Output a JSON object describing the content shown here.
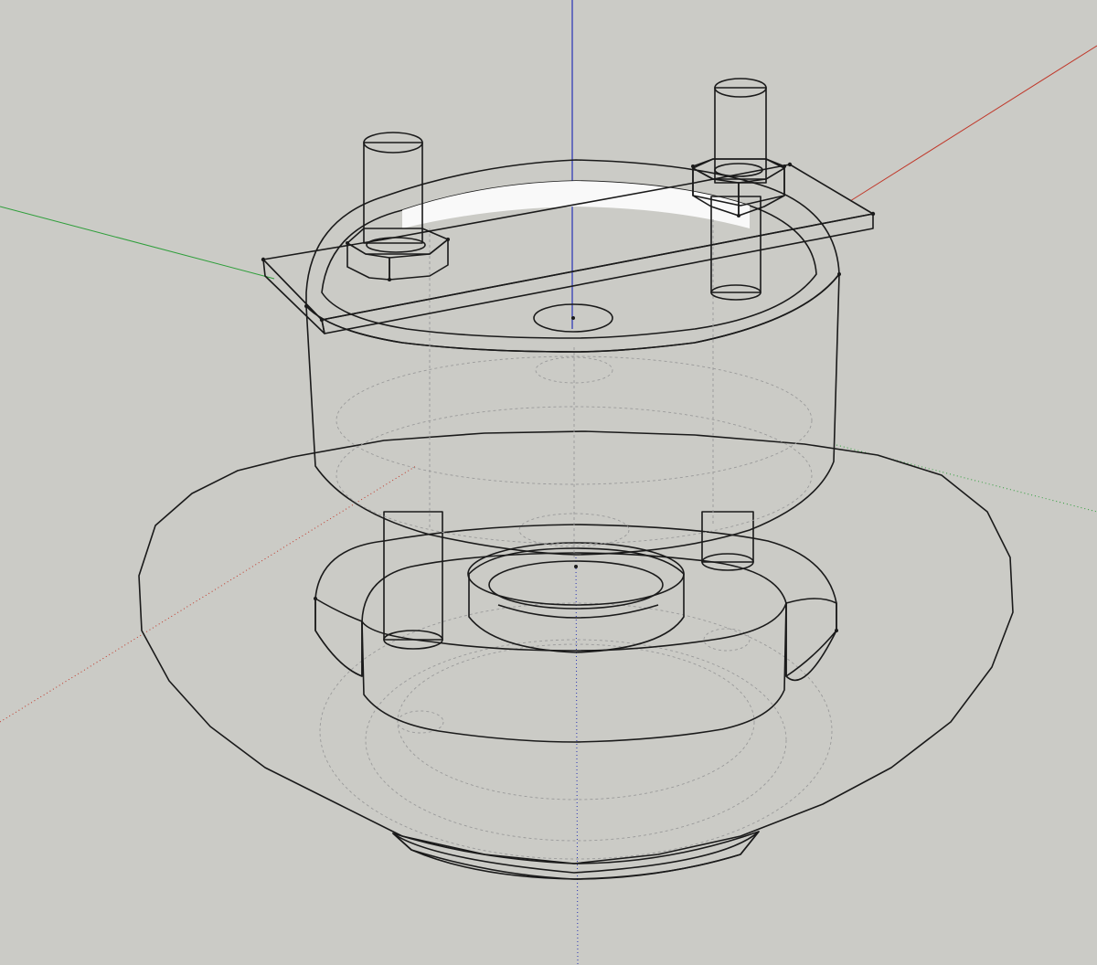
{
  "scene": {
    "background": "#cbcbc6",
    "face_color": "#f6f6f6",
    "shade_color": "#e2e2e2",
    "back_face_color": "#b8c7d2",
    "edge_color": "#1a1a1a",
    "hidden_edge_color": "#9a9a9a"
  },
  "axes": {
    "red": "#c0392b",
    "green": "#2e9e3a",
    "blue": "#2632b5"
  }
}
